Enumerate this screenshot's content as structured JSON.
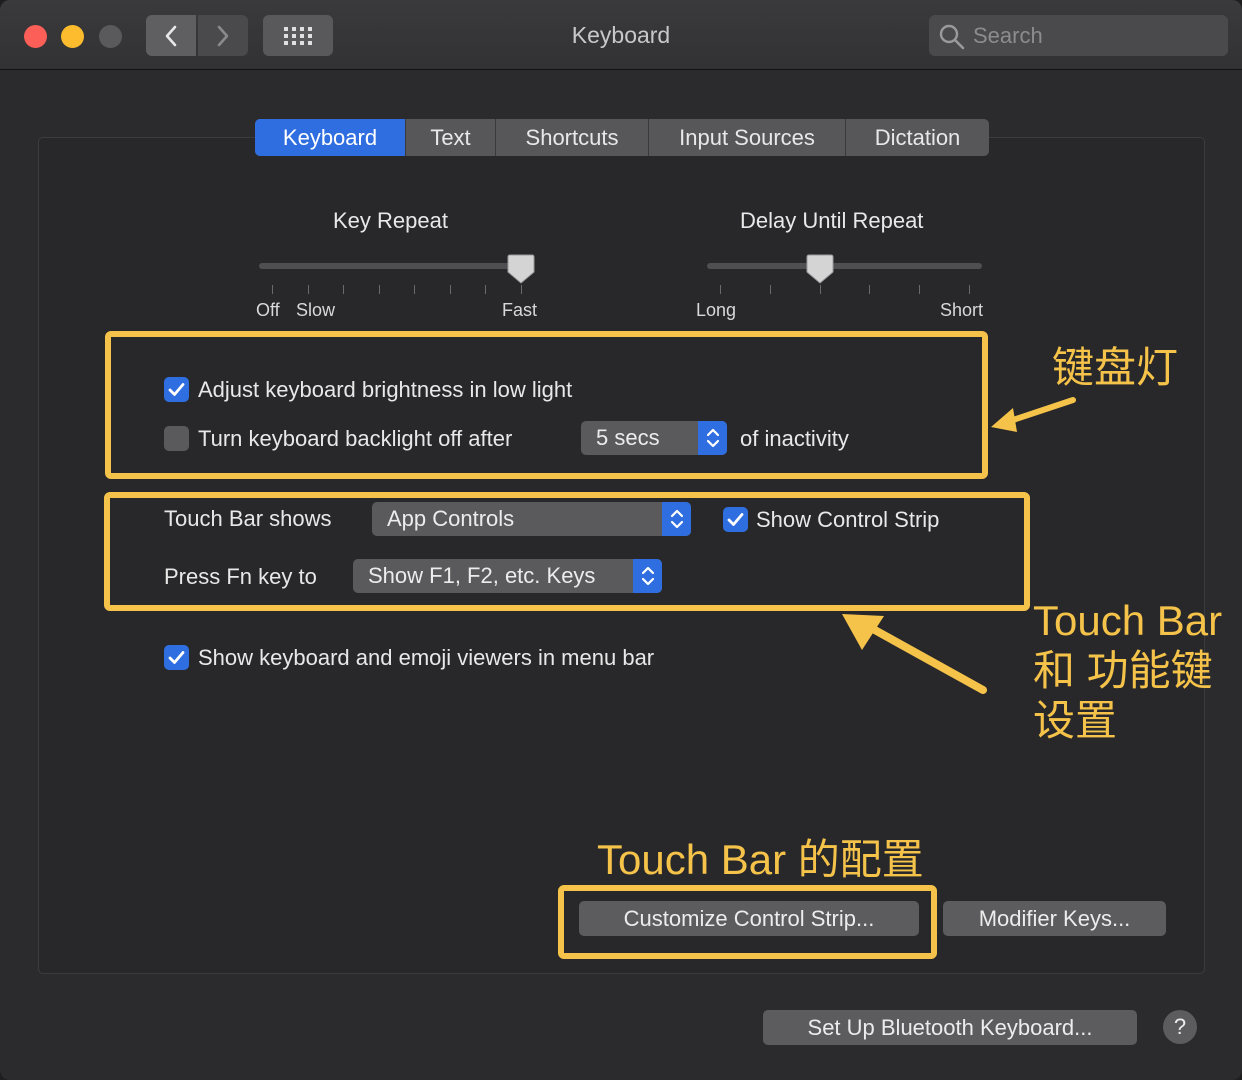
{
  "window": {
    "title": "Keyboard",
    "search_placeholder": "Search"
  },
  "tabs": [
    {
      "label": "Keyboard",
      "active": true
    },
    {
      "label": "Text",
      "active": false
    },
    {
      "label": "Shortcuts",
      "active": false
    },
    {
      "label": "Input Sources",
      "active": false
    },
    {
      "label": "Dictation",
      "active": false
    }
  ],
  "key_repeat": {
    "label": "Key Repeat",
    "tick_off": "Off",
    "tick_slow": "Slow",
    "tick_fast": "Fast",
    "tick_count": 8,
    "value_step": 7
  },
  "delay_until_repeat": {
    "label": "Delay Until Repeat",
    "tick_long": "Long",
    "tick_short": "Short",
    "tick_count": 6,
    "value_step": 2
  },
  "backlight": {
    "adjust_label": "Adjust keyboard brightness in low light",
    "adjust_checked": true,
    "turn_off_label": "Turn keyboard backlight off after",
    "turn_off_checked": false,
    "turn_off_value": "5 secs",
    "inactivity_label": "of inactivity"
  },
  "touch_bar": {
    "shows_label": "Touch Bar shows",
    "shows_value": "App Controls",
    "control_strip_label": "Show Control Strip",
    "control_strip_checked": true,
    "fn_label": "Press Fn key to",
    "fn_value": "Show F1, F2, etc. Keys"
  },
  "menu_bar": {
    "viewers_label": "Show keyboard and emoji viewers in menu bar",
    "viewers_checked": true
  },
  "buttons": {
    "customize": "Customize Control Strip...",
    "modifier": "Modifier Keys...",
    "bluetooth": "Set Up Bluetooth Keyboard...",
    "help": "?"
  },
  "annotations": {
    "backlight_note": "键盘灯",
    "touchbar_note_line1": "Touch Bar",
    "touchbar_note_line2": "和 功能键",
    "touchbar_note_line3": "设置",
    "customize_note": "Touch Bar 的配置",
    "color": "#f6c34a"
  },
  "colors": {
    "accent": "#2f6ee0",
    "highlight": "#f6c34a"
  }
}
